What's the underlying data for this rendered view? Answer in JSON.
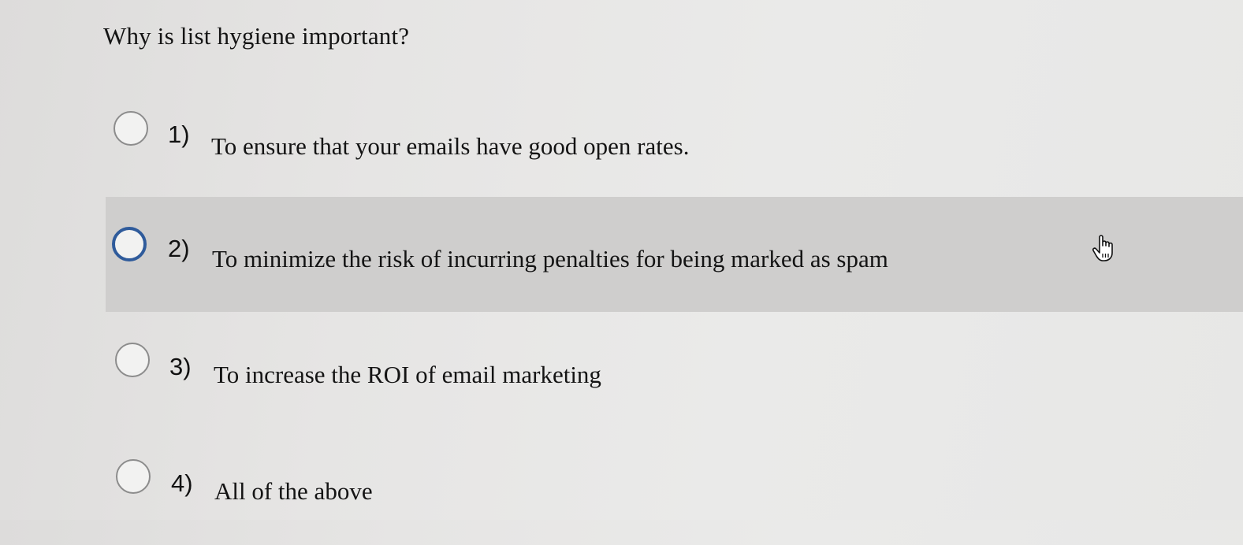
{
  "question": {
    "text": "Why is list hygiene important?"
  },
  "options": [
    {
      "number": "1)",
      "text": "To ensure that your emails have good open rates.",
      "selected": false,
      "hovered": false
    },
    {
      "number": "2)",
      "text": "To minimize the risk of incurring penalties for being marked as spam",
      "selected": false,
      "hovered": true
    },
    {
      "number": "3)",
      "text": "To increase the ROI of email marketing",
      "selected": false,
      "hovered": false
    },
    {
      "number": "4)",
      "text": "All of the above",
      "selected": false,
      "hovered": false
    }
  ],
  "cursor": {
    "icon": "hand-pointer-icon"
  },
  "colors": {
    "highlight": "#cfcecd",
    "focus_ring": "#2f5b9b"
  }
}
